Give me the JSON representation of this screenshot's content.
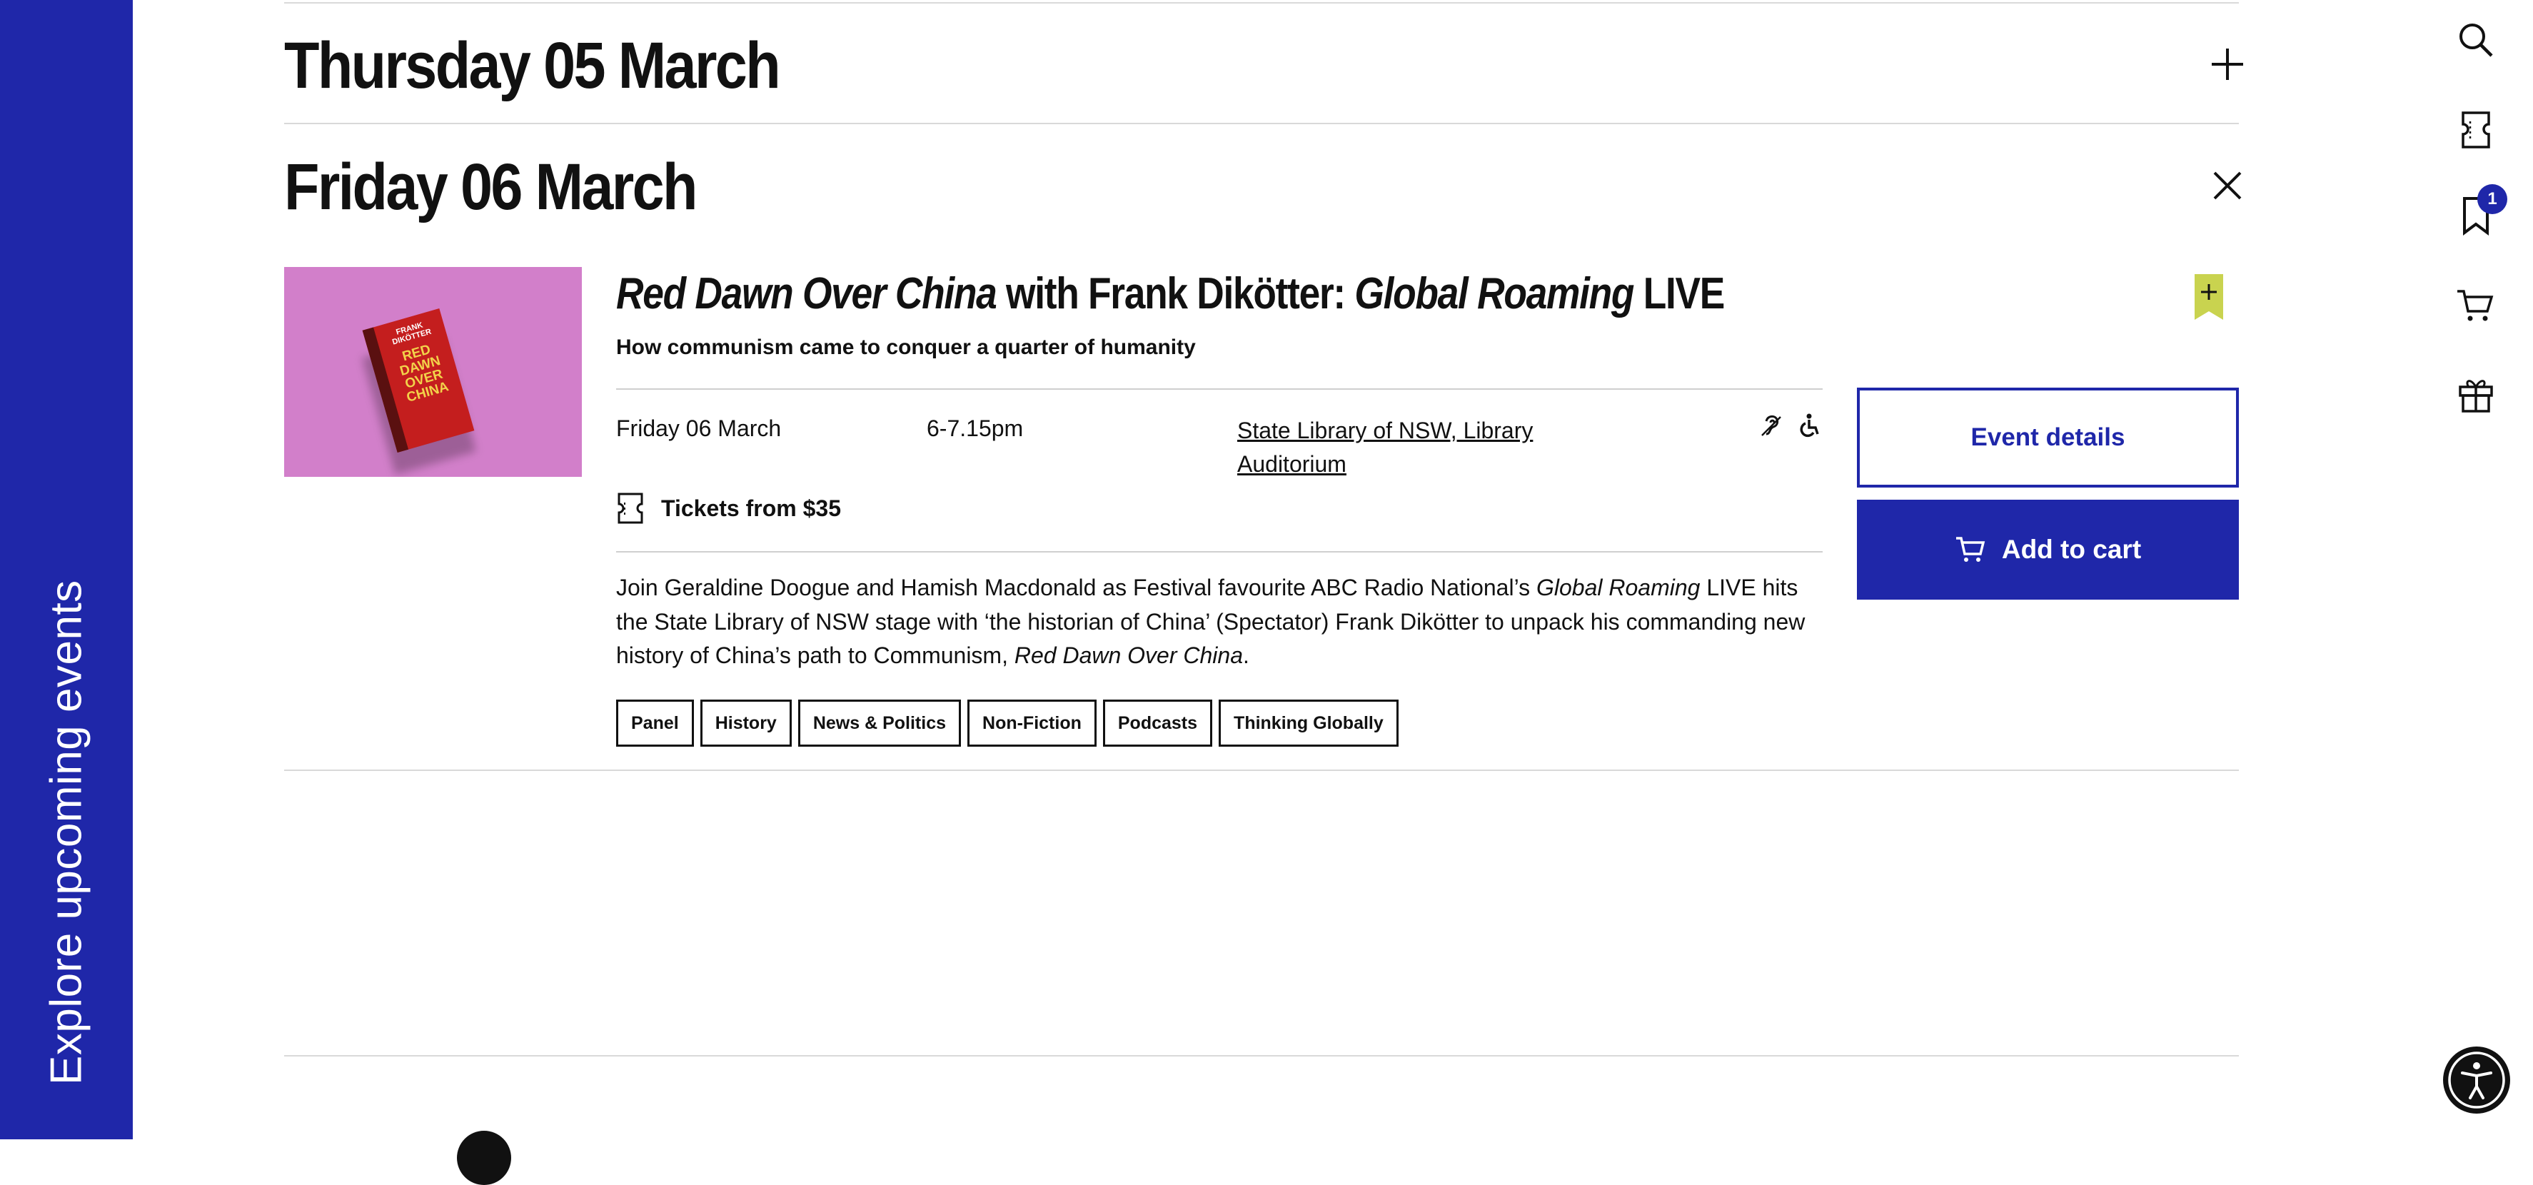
{
  "sidebar": {
    "label": "Explore upcoming events"
  },
  "days": [
    {
      "title": "Thursday 05 March",
      "toggle_icon": "plus-icon",
      "expanded": false
    },
    {
      "title": "Friday 06 March",
      "toggle_icon": "close-icon",
      "expanded": true
    }
  ],
  "event": {
    "title_part1": "Red Dawn Over China",
    "title_part2": " with Frank Dikötter: ",
    "title_part3": "Global Roaming",
    "title_part4": " LIVE",
    "subtitle": "How communism came to conquer a quarter of humanity",
    "date": "Friday 06 March",
    "time": "6-7.15pm",
    "venue": "State Library of NSW, Library Auditorium",
    "accessibility_icons": [
      "hearing-loop-icon",
      "wheelchair-icon"
    ],
    "tickets": "Tickets from $35",
    "description_part1": "Join Geraldine Doogue and Hamish Macdonald as Festival favourite ABC Radio National’s ",
    "description_part2": "Global Roaming",
    "description_part3": " LIVE hits the State Library of NSW stage with ‘the historian of China’ (Spectator) Frank Dikötter to unpack his commanding new history of China’s path to Communism, ",
    "description_part4": "Red Dawn Over China",
    "description_part5": ".",
    "tags": [
      "Panel",
      "History",
      "News & Politics",
      "Non-Fiction",
      "Podcasts",
      "Thinking Globally"
    ],
    "buttons": {
      "details": "Event details",
      "cart": "Add to cart"
    },
    "book_cover": {
      "author": "FRANK DIKÖTTER",
      "title": "RED DAWN OVER CHINA"
    }
  },
  "right_rail": {
    "icons": [
      "search-icon",
      "ticket-icon",
      "bookmark-icon",
      "cart-icon",
      "gift-icon"
    ],
    "bookmark_badge": "1"
  },
  "colors": {
    "brand": "#1f27a9",
    "tag_accent": "#c9d34f"
  }
}
